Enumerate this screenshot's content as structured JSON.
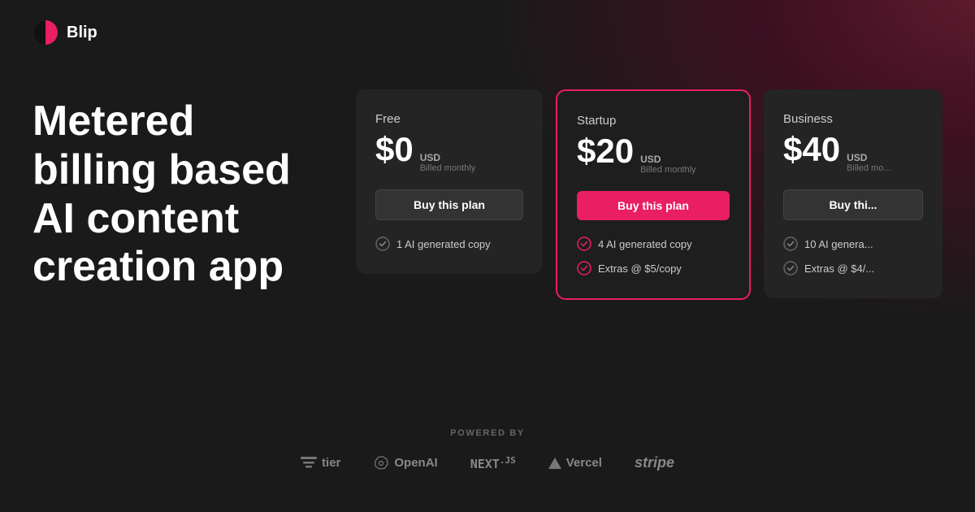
{
  "app": {
    "name": "Blip"
  },
  "hero": {
    "title_line1": "Metered billing based",
    "title_line2": "AI content creation app"
  },
  "plans": [
    {
      "id": "free",
      "name": "Free",
      "price": "$0",
      "currency": "USD",
      "billing": "Billed monthly",
      "button_label": "Buy this plan",
      "button_style": "default",
      "features": [
        "1 AI generated copy"
      ]
    },
    {
      "id": "startup",
      "name": "Startup",
      "price": "$20",
      "currency": "USD",
      "billing": "Billed monthly",
      "button_label": "Buy this plan",
      "button_style": "featured",
      "features": [
        "4 AI generated copy",
        "Extras @ $5/copy"
      ]
    },
    {
      "id": "business",
      "name": "Business",
      "price": "$40",
      "currency": "USD",
      "billing": "Billed mo...",
      "button_label": "Buy thi...",
      "button_style": "default",
      "features": [
        "10 AI genera...",
        "Extras @ $4/..."
      ]
    }
  ],
  "powered_by": {
    "label": "POWERED BY",
    "brands": [
      "tier",
      "OpenAI",
      "NEXT.js",
      "Vercel",
      "stripe"
    ]
  }
}
